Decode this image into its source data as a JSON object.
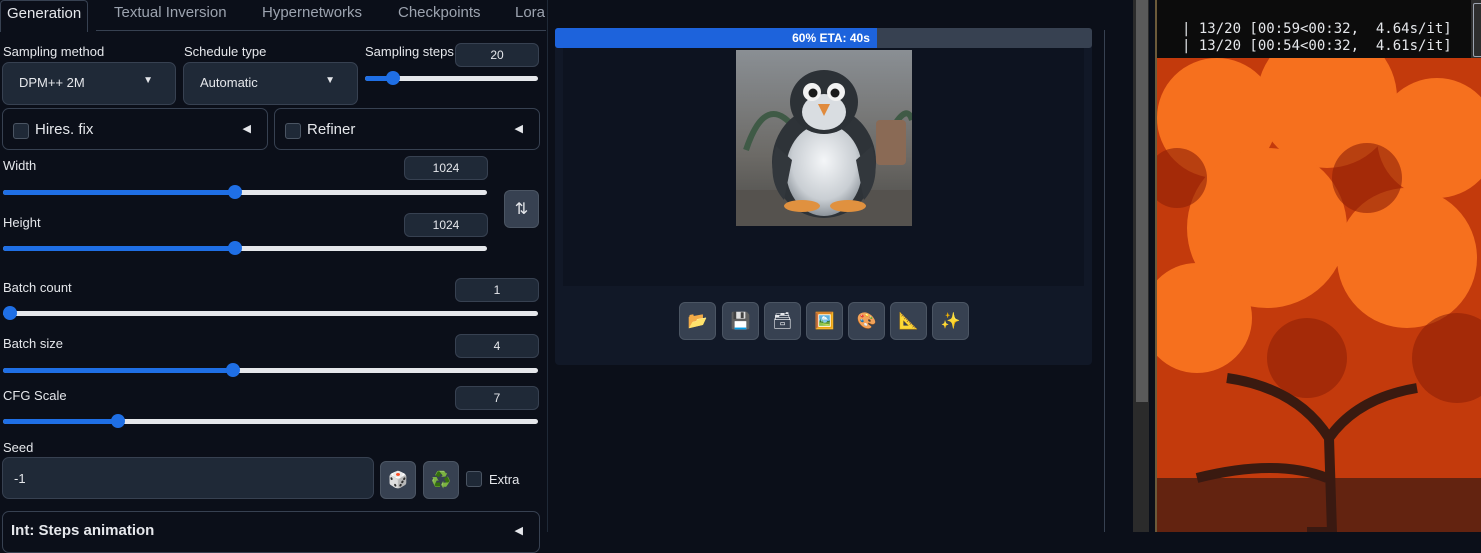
{
  "tabs": [
    "Generation",
    "Textual Inversion",
    "Hypernetworks",
    "Checkpoints",
    "Lora"
  ],
  "sampling": {
    "method_label": "Sampling method",
    "method_value": "DPM++ 2M",
    "schedule_label": "Schedule type",
    "schedule_value": "Automatic",
    "steps_label": "Sampling steps",
    "steps_value": "20",
    "steps_fraction": 0.16
  },
  "accordions": {
    "hires": "Hires. fix",
    "refiner": "Refiner",
    "steps_anim": "Int: Steps animation"
  },
  "dimensions": {
    "width_label": "Width",
    "width_value": "1024",
    "width_fraction": 0.48,
    "height_label": "Height",
    "height_value": "1024",
    "height_fraction": 0.48
  },
  "batch": {
    "count_label": "Batch count",
    "count_value": "1",
    "count_fraction": 0.0,
    "size_label": "Batch size",
    "size_value": "4",
    "size_fraction": 0.43
  },
  "cfg": {
    "label": "CFG Scale",
    "value": "7",
    "fraction": 0.215
  },
  "seed": {
    "label": "Seed",
    "value": "-1",
    "extra_label": "Extra"
  },
  "progress": {
    "text": "60% ETA: 40s",
    "fraction": 0.6
  },
  "terminal": {
    "line1": "| 13/20 [00:59<00:32,  4.64s/it]",
    "line2": "| 13/20 [00:54<00:32,  4.61s/it]"
  },
  "icons": {
    "swap": "⇅",
    "dice": "🎲",
    "recycle": "♻️",
    "folder": "📂",
    "save": "💾",
    "zip": "🗃",
    "image": "🖼️",
    "palette": "🎨",
    "ruler": "📐",
    "sparkles": "✨"
  },
  "colors": {
    "accent": "#1f6fe5",
    "background": "#0b0f19"
  }
}
